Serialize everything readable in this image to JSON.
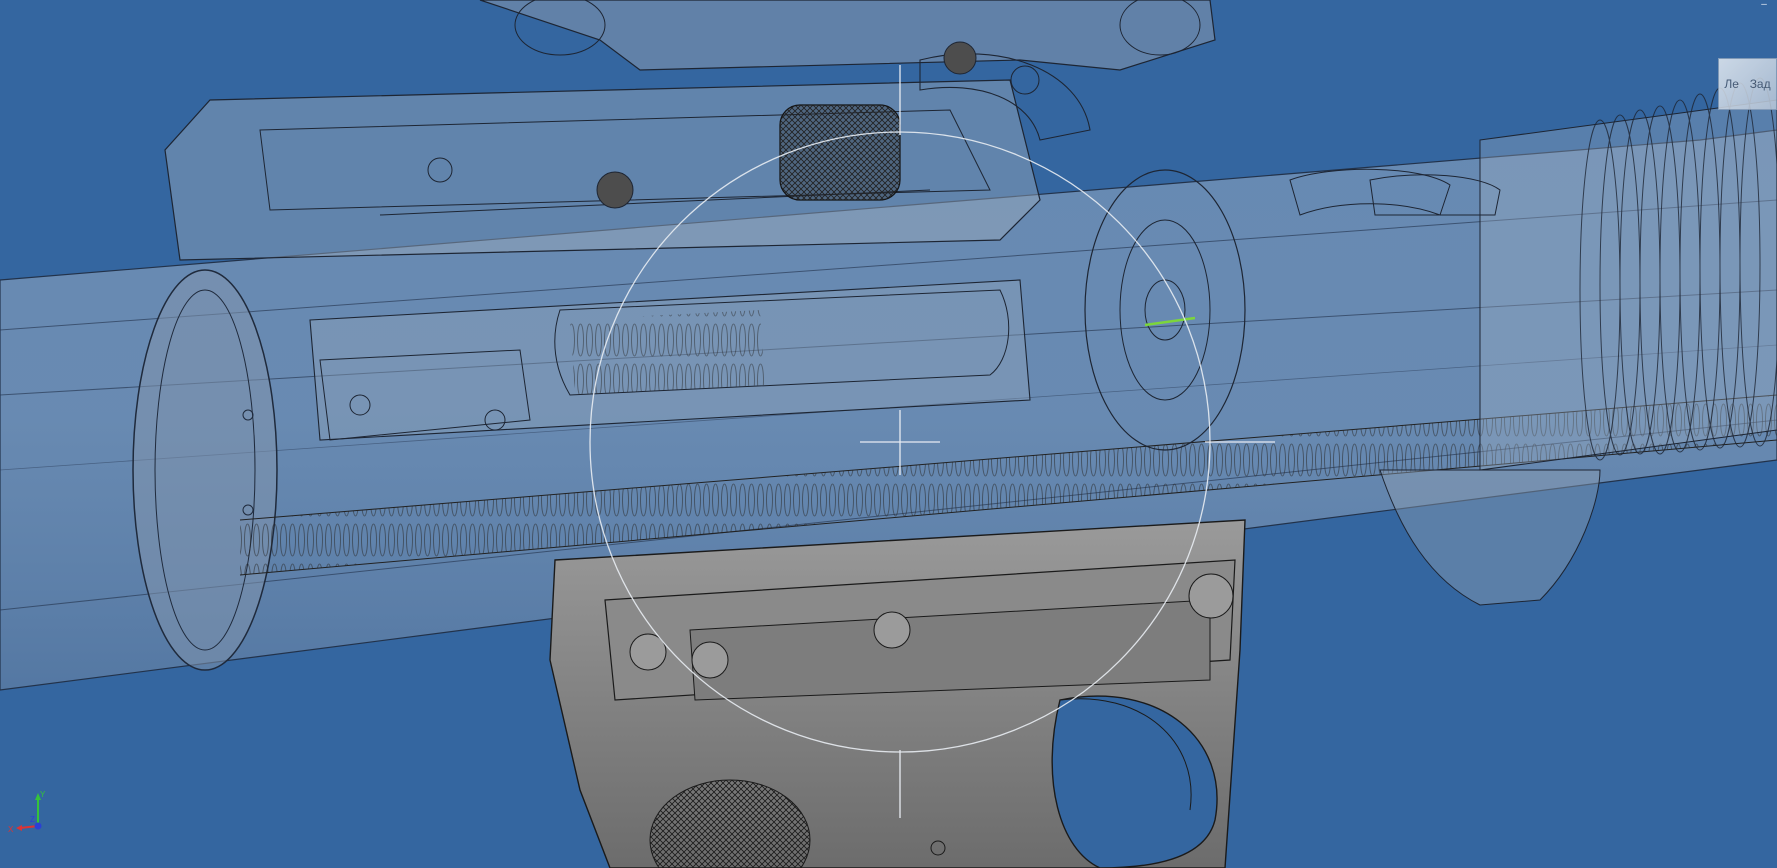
{
  "app": {
    "window_title": ""
  },
  "viewport": {
    "background": "#3466a0",
    "model_color": "#8a8a8a",
    "wire_color": "#1e1e1e",
    "highlight_color": "#7cd63b"
  },
  "viewcube": {
    "left_face": "Ле",
    "right_face": "Зад"
  },
  "window_controls": {
    "minimize": "–"
  },
  "triad": {
    "x_label": "X",
    "y_label": "Y",
    "z_label": "Z"
  },
  "icons": {
    "triad": "xyz-triad-icon",
    "viewcube": "view-cube-icon",
    "rotate_cursor": "rotate-cursor-icon"
  }
}
